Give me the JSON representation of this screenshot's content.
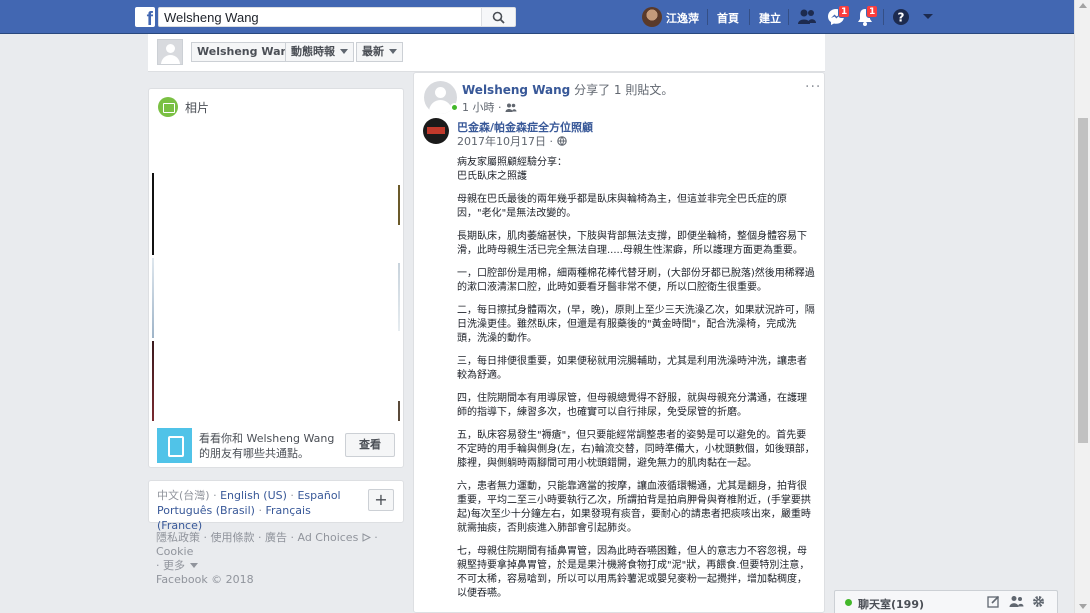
{
  "topbar": {
    "logo": "f",
    "search_value": "Welsheng Wang",
    "user_name": "江逸萍",
    "home": "首頁",
    "create": "建立",
    "messages_badge": "1",
    "notifications_badge": "1"
  },
  "profile_bar": {
    "name_button": "Welsheng Wang",
    "timeline_button": "動態時報",
    "recent_button": "最新"
  },
  "photos": {
    "title": "相片",
    "prompt_line1": "看看你和 Welsheng Wang",
    "prompt_line2": "的朋友有哪些共通點。",
    "see_button": "查看"
  },
  "languages": {
    "current": "中文(台灣)",
    "items": [
      "English (US)",
      "Español",
      "Português (Brasil)",
      "Français (France)"
    ],
    "sep": " · "
  },
  "footer": {
    "links": [
      "隱私政策",
      "使用條款",
      "廣告",
      "Ad Choices",
      "Cookie",
      "更多"
    ],
    "copyright": "Facebook © 2018"
  },
  "post": {
    "author": "Welsheng Wang",
    "action": "分享了 1 則貼文。",
    "time": "1 小時",
    "menu": "···",
    "shared_page": "巴金森/帕金森症全方位照顧",
    "shared_date": "2017年10月17日",
    "paragraphs": [
      "病友家屬照顧經驗分享：\n巴氏臥床之照護",
      "母親在巴氏最後的兩年幾乎都是臥床與輪椅為主，但這並非完全巴氏症的原因，\"老化\"是無法改變的。",
      "長期臥床，肌肉萎縮甚快，下肢與背部無法支撐，即便坐輪椅，整個身體容易下滑，此時母親生活已完全無法自理.....母親生性潔癖，所以護理方面更為重要。",
      "一，口腔部份是用棉，細兩種棉花棒代替牙刷，(大部份牙都已脫落)然後用稀釋過的漱口液清潔口腔，此時如要看牙醫非常不便，所以口腔衛生很重要。",
      "二，每日擦拭身體兩次，(早，晚)，原則上至少三天洗澡乙次，如果狀況許可，隔日洗澡更佳。雖然臥床，但還是有服藥後的\"黃金時間\"，配合洗澡椅，完成洗頭，洗澡的動作。",
      "三，每日排便很重要，如果便秘就用浣腸輔助，尤其是利用洗澡時沖洗，讓患者較為舒適。",
      "四，住院期間本有用導尿管，但母親總覺得不舒服，就與母親充分溝通，在護理師的指導下，練習多次，也確實可以自行排尿，免受尿管的折磨。",
      "五，臥床容易發生\"褥瘡\"，但只要能經常調整患者的姿勢是可以避免的。首先要不定時的用手輪與側身(左，右)輪流交替，同時準備大，小枕頭數個，如後頸部，膝裡，與側躺時兩腳間可用小枕頭錯開，避免無力的肌肉黏在一起。",
      "六，患者無力運動，只能靠適當的按摩，讓血液循環暢通，尤其是翻身，拍背很重要，平均二至三小時要執行乙次，所謂拍背是拍肩胛骨與脊椎附近，(手掌要拱起)每次至少十分鐘左右，如果發現有痰音，要耐心的請患者把痰咳出來，嚴重時就需抽痰，否則痰進入肺部會引起肺炎。",
      "七，母親住院期間有插鼻胃管，因為此時吞嚥困難，但人的意志力不容忽視，母親堅持要拿掉鼻胃管，於是是果汁機將食物打成\"泥\"狀，再餵食.但要特別注意，不可太稀，容易嗆到，所以可以用馬鈴薯泥或嬰兒麥粉一起攪拌，增加黏稠度，以便吞嚥。"
    ]
  },
  "chat": {
    "label": "聊天室(199)"
  },
  "colors": {
    "brand": "#4267b2",
    "link": "#385898",
    "online": "#42b72a",
    "badge": "#fa3e3e"
  }
}
